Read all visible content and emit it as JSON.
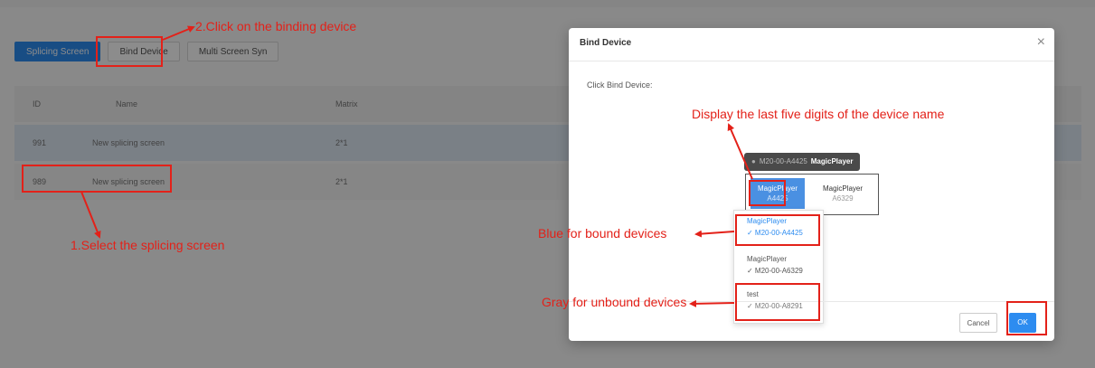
{
  "tabs": [
    "Splicing Screen",
    "Bind Device",
    "Multi Screen Syn"
  ],
  "table": {
    "headers": [
      "ID",
      "Name",
      "Matrix"
    ],
    "rows": [
      {
        "id": "991",
        "name": "New splicing screen",
        "matrix": "2*1"
      },
      {
        "id": "989",
        "name": "New splicing screen",
        "matrix": "2*1"
      }
    ]
  },
  "modal": {
    "title": "Bind Device",
    "close": "×",
    "prompt": "Click Bind Device:",
    "tooltip": {
      "dot": "●",
      "code": "M20-00-A4425",
      "name": "MagicPlayer"
    },
    "cells": [
      {
        "name": "MagicPlayer",
        "code": "A4425"
      },
      {
        "name": "MagicPlayer",
        "code": "A6329"
      }
    ],
    "dropdown": [
      {
        "name": "MagicPlayer",
        "code": "✓ M20-00-A4425"
      },
      {
        "name": "MagicPlayer",
        "code": "✓ M20-00-A6329"
      },
      {
        "name": "test",
        "code": "✓ M20-00-A8291"
      }
    ],
    "cancel": "Cancel",
    "ok": "OK"
  },
  "annotations": {
    "step2": "2.Click on the binding device",
    "step1": "1.Select the splicing screen",
    "last_five": "Display the last five digits of the device name",
    "blue_bound": "Blue for bound devices",
    "gray_unbound": "Gray for unbound devices"
  },
  "colors": {
    "annotation": "#e32119",
    "primary": "#2d8cf0"
  }
}
